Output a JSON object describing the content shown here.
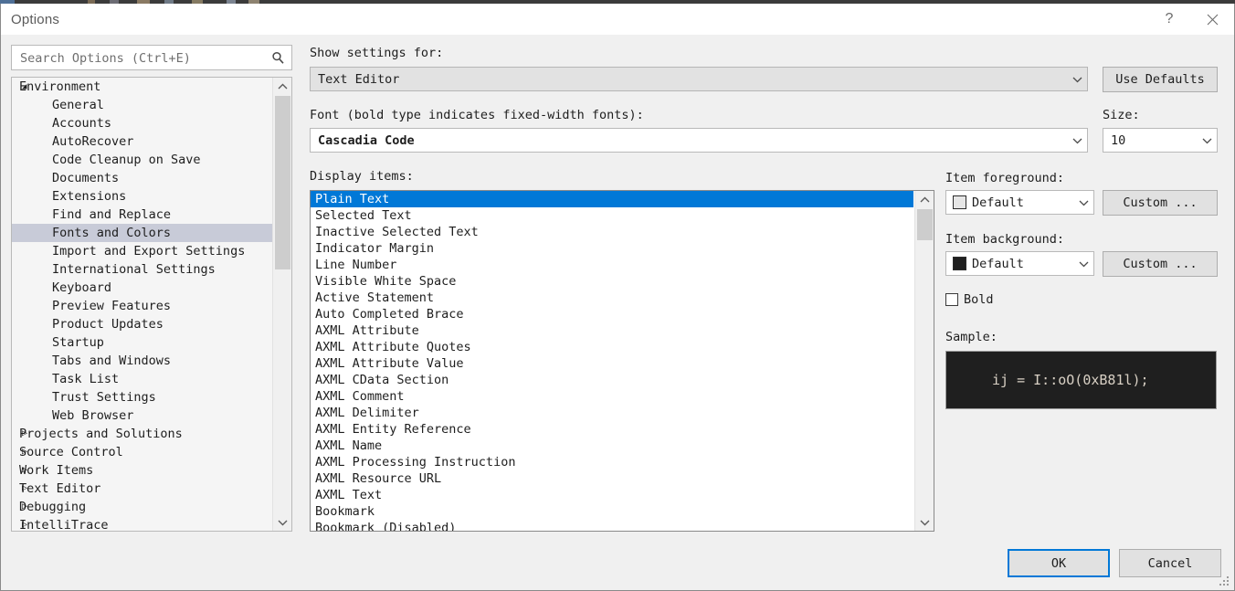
{
  "window": {
    "title": "Options",
    "help_button": "?",
    "close_button": "✕"
  },
  "search": {
    "placeholder": "Search Options (Ctrl+E)",
    "value": "",
    "icon": "search-icon"
  },
  "tree": {
    "items": [
      {
        "label": "Environment",
        "level": 0,
        "expander": "expanded",
        "selected": false
      },
      {
        "label": "General",
        "level": 1,
        "expander": "none",
        "selected": false
      },
      {
        "label": "Accounts",
        "level": 1,
        "expander": "none",
        "selected": false
      },
      {
        "label": "AutoRecover",
        "level": 1,
        "expander": "none",
        "selected": false
      },
      {
        "label": "Code Cleanup on Save",
        "level": 1,
        "expander": "none",
        "selected": false
      },
      {
        "label": "Documents",
        "level": 1,
        "expander": "none",
        "selected": false
      },
      {
        "label": "Extensions",
        "level": 1,
        "expander": "none",
        "selected": false
      },
      {
        "label": "Find and Replace",
        "level": 1,
        "expander": "none",
        "selected": false
      },
      {
        "label": "Fonts and Colors",
        "level": 1,
        "expander": "none",
        "selected": true
      },
      {
        "label": "Import and Export Settings",
        "level": 1,
        "expander": "none",
        "selected": false
      },
      {
        "label": "International Settings",
        "level": 1,
        "expander": "none",
        "selected": false
      },
      {
        "label": "Keyboard",
        "level": 1,
        "expander": "none",
        "selected": false
      },
      {
        "label": "Preview Features",
        "level": 1,
        "expander": "none",
        "selected": false
      },
      {
        "label": "Product Updates",
        "level": 1,
        "expander": "none",
        "selected": false
      },
      {
        "label": "Startup",
        "level": 1,
        "expander": "none",
        "selected": false
      },
      {
        "label": "Tabs and Windows",
        "level": 1,
        "expander": "none",
        "selected": false
      },
      {
        "label": "Task List",
        "level": 1,
        "expander": "none",
        "selected": false
      },
      {
        "label": "Trust Settings",
        "level": 1,
        "expander": "none",
        "selected": false
      },
      {
        "label": "Web Browser",
        "level": 1,
        "expander": "none",
        "selected": false
      },
      {
        "label": "Projects and Solutions",
        "level": 0,
        "expander": "collapsed",
        "selected": false
      },
      {
        "label": "Source Control",
        "level": 0,
        "expander": "collapsed",
        "selected": false
      },
      {
        "label": "Work Items",
        "level": 0,
        "expander": "collapsed",
        "selected": false
      },
      {
        "label": "Text Editor",
        "level": 0,
        "expander": "collapsed",
        "selected": false
      },
      {
        "label": "Debugging",
        "level": 0,
        "expander": "collapsed",
        "selected": false
      },
      {
        "label": "IntelliTrace",
        "level": 0,
        "expander": "collapsed",
        "selected": false
      }
    ],
    "scroll": {
      "up_arrow": "⌃",
      "down_arrow": "⌄"
    }
  },
  "main": {
    "show_settings_label": "Show settings for:",
    "show_settings_value": "Text Editor",
    "use_defaults_label": "Use Defaults",
    "font_label": "Font (bold type indicates fixed-width fonts):",
    "font_value": "Cascadia Code",
    "size_label": "Size:",
    "size_value": "10",
    "display_items_label": "Display items:",
    "display_items": [
      "Plain Text",
      "Selected Text",
      "Inactive Selected Text",
      "Indicator Margin",
      "Line Number",
      "Visible White Space",
      "Active Statement",
      "Auto Completed Brace",
      "AXML Attribute",
      "AXML Attribute Quotes",
      "AXML Attribute Value",
      "AXML CData Section",
      "AXML Comment",
      "AXML Delimiter",
      "AXML Entity Reference",
      "AXML Name",
      "AXML Processing Instruction",
      "AXML Resource URL",
      "AXML Text",
      "Bookmark",
      "Bookmark (Disabled)"
    ],
    "display_items_selected_index": 0,
    "item_foreground_label": "Item foreground:",
    "item_foreground_value": "Default",
    "item_foreground_swatch": "#e6e6e6",
    "item_foreground_custom_label": "Custom ...",
    "item_background_label": "Item background:",
    "item_background_value": "Default",
    "item_background_swatch": "#1f1f1f",
    "item_background_custom_label": "Custom ...",
    "bold_label": "Bold",
    "bold_checked": false,
    "sample_label": "Sample:",
    "sample_text": "ij = I::oO(0xB81l);",
    "sample_bg": "#1f1f1f",
    "sample_fg": "#d8d0c4",
    "dropdown_arrow": "⌄"
  },
  "footer": {
    "ok_label": "OK",
    "cancel_label": "Cancel"
  },
  "colors": {
    "selection_blue": "#0078d7",
    "tree_selection": "#c8cbd8",
    "dialog_bg": "#f0f0f0"
  }
}
